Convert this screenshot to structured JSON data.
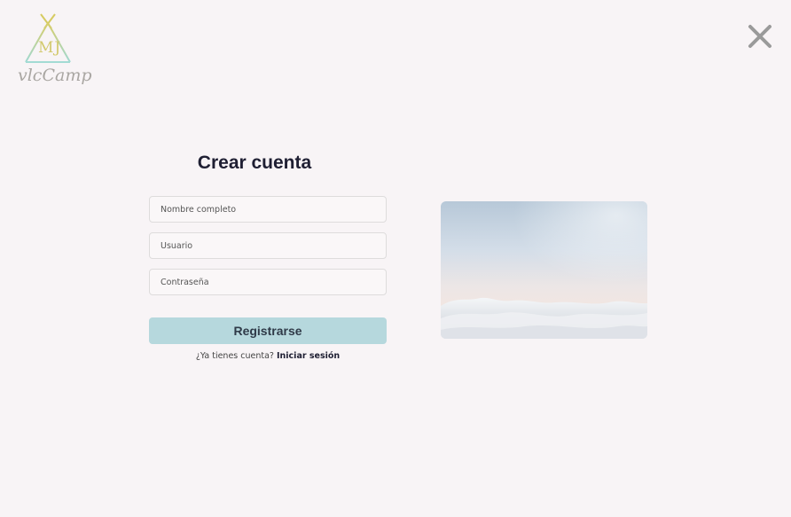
{
  "logo": {
    "initials": "MJ",
    "brand": "vlcCamp"
  },
  "page": {
    "title": "Crear cuenta"
  },
  "form": {
    "fullname_placeholder": "Nombre completo",
    "username_placeholder": "Usuario",
    "password_placeholder": "Contraseña",
    "submit_label": "Registrarse",
    "login_prompt": "¿Ya tienes cuenta?",
    "login_link": "Iniciar sesión"
  },
  "icons": {
    "close": "close-icon",
    "logo": "teepee-logo"
  },
  "colors": {
    "background": "#f8f4f6",
    "accent": "#b6d8dd",
    "text_dark": "#1f1f33"
  }
}
